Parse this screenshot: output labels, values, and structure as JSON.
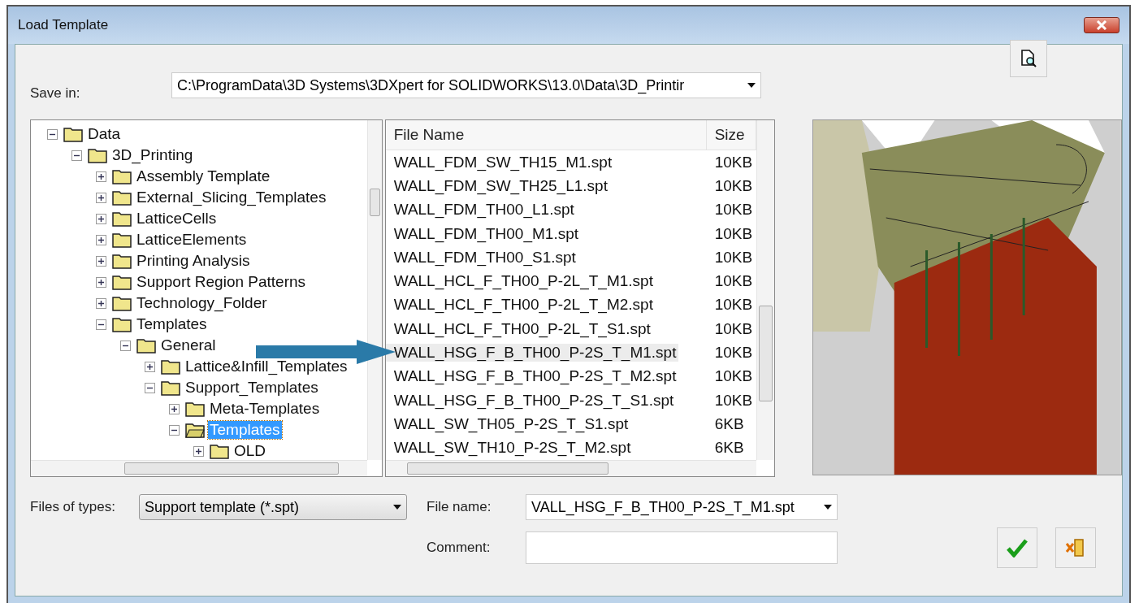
{
  "window": {
    "title": "Load Template"
  },
  "save_in": {
    "label": "Save in:",
    "value": "C:\\ProgramData\\3D Systems\\3DXpert for SOLIDWORKS\\13.0\\Data\\3D_Printir"
  },
  "tree": [
    {
      "label": "Data",
      "expanded": true,
      "selected": false,
      "children": [
        {
          "label": "3D_Printing",
          "expanded": true,
          "selected": false,
          "children": [
            {
              "label": "Assembly Template",
              "expanded": false,
              "selected": false
            },
            {
              "label": "External_Slicing_Templates",
              "expanded": false,
              "selected": false
            },
            {
              "label": "LatticeCells",
              "expanded": false,
              "selected": false
            },
            {
              "label": "LatticeElements",
              "expanded": false,
              "selected": false
            },
            {
              "label": "Printing Analysis",
              "expanded": false,
              "selected": false
            },
            {
              "label": "Support Region Patterns",
              "expanded": false,
              "selected": false
            },
            {
              "label": "Technology_Folder",
              "expanded": false,
              "selected": false
            },
            {
              "label": "Templates",
              "expanded": true,
              "selected": false,
              "children": [
                {
                  "label": "General",
                  "expanded": true,
                  "selected": false,
                  "children": [
                    {
                      "label": "Lattice&Infill_Templates",
                      "expanded": false,
                      "selected": false
                    },
                    {
                      "label": "Support_Templates",
                      "expanded": true,
                      "selected": false,
                      "children": [
                        {
                          "label": "Meta-Templates",
                          "expanded": false,
                          "selected": false
                        },
                        {
                          "label": "Templates",
                          "expanded": true,
                          "selected": true,
                          "children": [
                            {
                              "label": "OLD",
                              "expanded": false,
                              "selected": false
                            }
                          ]
                        }
                      ]
                    }
                  ]
                }
              ]
            }
          ]
        }
      ]
    }
  ],
  "files": {
    "columns": [
      "File Name",
      "Size"
    ],
    "rows": [
      {
        "name": "WALL_FDM_SW_TH15_M1.spt",
        "size": "10KB",
        "selected": false
      },
      {
        "name": "WALL_FDM_SW_TH25_L1.spt",
        "size": "10KB",
        "selected": false
      },
      {
        "name": "WALL_FDM_TH00_L1.spt",
        "size": "10KB",
        "selected": false
      },
      {
        "name": "WALL_FDM_TH00_M1.spt",
        "size": "10KB",
        "selected": false
      },
      {
        "name": "WALL_FDM_TH00_S1.spt",
        "size": "10KB",
        "selected": false
      },
      {
        "name": "WALL_HCL_F_TH00_P-2L_T_M1.spt",
        "size": "10KB",
        "selected": false
      },
      {
        "name": "WALL_HCL_F_TH00_P-2L_T_M2.spt",
        "size": "10KB",
        "selected": false
      },
      {
        "name": "WALL_HCL_F_TH00_P-2L_T_S1.spt",
        "size": "10KB",
        "selected": false
      },
      {
        "name": "WALL_HSG_F_B_TH00_P-2S_T_M1.spt",
        "size": "10KB",
        "selected": true
      },
      {
        "name": "WALL_HSG_F_B_TH00_P-2S_T_M2.spt",
        "size": "10KB",
        "selected": false
      },
      {
        "name": "WALL_HSG_F_B_TH00_P-2S_T_S1.spt",
        "size": "10KB",
        "selected": false
      },
      {
        "name": "WALL_SW_TH05_P-2S_T_S1.spt",
        "size": "6KB",
        "selected": false
      },
      {
        "name": "WALL_SW_TH10_P-2S_T_M2.spt",
        "size": "6KB",
        "selected": false
      }
    ]
  },
  "file_types": {
    "label": "Files of types:",
    "value": "Support template (*.spt)"
  },
  "file_name": {
    "label": "File name:",
    "value": "VALL_HSG_F_B_TH00_P-2S_T_M1.spt"
  },
  "comment": {
    "label": "Comment:"
  }
}
